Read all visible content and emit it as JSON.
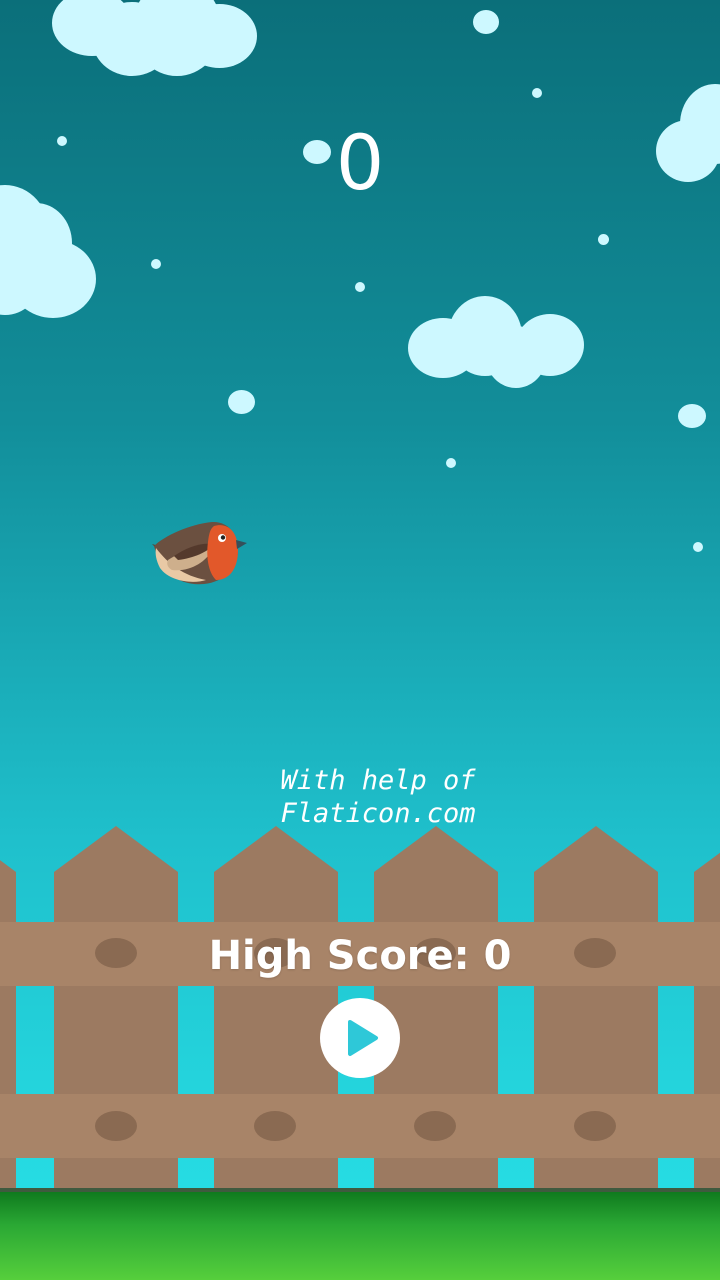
{
  "game": {
    "score": "0",
    "credit_line1": "With help of",
    "credit_line2": "Flaticon.com",
    "high_score_label": "High Score: 0"
  },
  "colors": {
    "sky_top": "#0b6f7a",
    "sky_bottom": "#26dde4",
    "cloud": "#cdf8ff",
    "fence": "#9c7a61",
    "fence_rail": "#a88468",
    "knot": "#8a6a52",
    "grass": "#2aa834",
    "play_icon": "#2ec8d8",
    "bird_breast": "#e2582a",
    "bird_body": "#6b5040"
  },
  "icons": {
    "play_button": "play-icon",
    "player": "robin-bird-icon"
  }
}
